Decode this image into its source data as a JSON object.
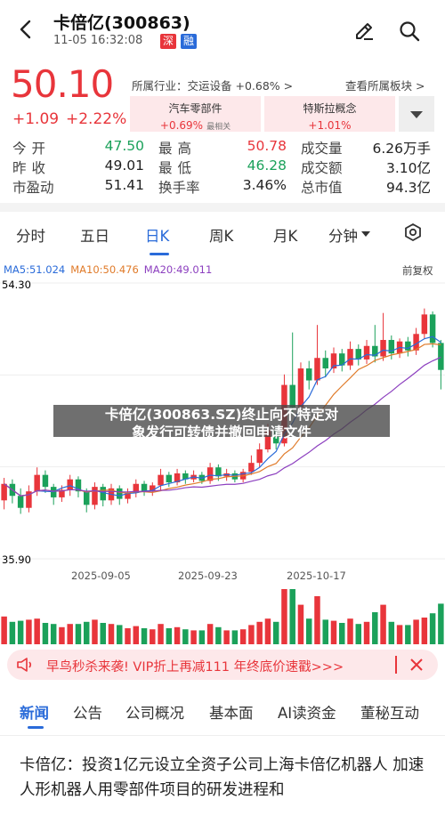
{
  "header": {
    "title": "卡倍亿(300863)",
    "time": "11-05 16:32:08",
    "tag_shen": "深",
    "tag_rong": "融"
  },
  "quote": {
    "price": "50.10",
    "change": "+1.09",
    "change_pct": "+2.22%",
    "industry": "所属行业：交运设备 +0.68% >",
    "view_sector": "查看所属板块 >",
    "sectors": [
      {
        "name": "汽车零部件",
        "pct": "+0.69%",
        "lead": "最相关"
      },
      {
        "name": "特斯拉概念",
        "pct": "+1.01%"
      }
    ]
  },
  "stats": {
    "row1": [
      {
        "label": "今开",
        "value": "47.50",
        "color": "#1ba15a"
      },
      {
        "label": "最高",
        "value": "50.78",
        "color": "#e8353b"
      },
      {
        "label": "成交量",
        "value": "6.26万手",
        "color": "#222222"
      }
    ],
    "row2": [
      {
        "label": "昨收",
        "value": "49.01",
        "color": "#222222"
      },
      {
        "label": "最低",
        "value": "46.28",
        "color": "#1ba15a"
      },
      {
        "label": "成交额",
        "value": "3.10亿",
        "color": "#222222"
      }
    ],
    "row3": [
      {
        "label": "市盈动",
        "value": "51.41",
        "color": "#222222"
      },
      {
        "label": "换手率",
        "value": "3.46%",
        "color": "#222222"
      },
      {
        "label": "总市值",
        "value": "94.3亿",
        "color": "#222222"
      }
    ]
  },
  "tabs": [
    "分时",
    "五日",
    "日K",
    "周K",
    "月K",
    "分钟"
  ],
  "chart": {
    "ma5": "MA5:51.024",
    "ma10": "MA10:50.476",
    "ma20": "MA20:49.011",
    "adjust": "前复权",
    "ymax": "54.30",
    "ymin": "35.90",
    "dates": [
      "2025-09-05",
      "2025-09-23",
      "2025-10-17"
    ]
  },
  "chart_data": {
    "type": "candlestick",
    "ylim": [
      35.9,
      54.3
    ],
    "x_ticks": [
      "2025-09-05",
      "2025-09-23",
      "2025-10-17"
    ],
    "candles": [
      [
        39.8,
        40.9,
        39.2,
        41.3
      ],
      [
        40.9,
        40.1,
        39.6,
        41.2
      ],
      [
        40.1,
        39.3,
        38.9,
        40.6
      ],
      [
        39.3,
        40.4,
        39.0,
        40.8
      ],
      [
        40.4,
        41.5,
        40.1,
        42.0
      ],
      [
        41.5,
        40.7,
        40.3,
        41.8
      ],
      [
        40.7,
        40.0,
        39.5,
        40.9
      ],
      [
        40.0,
        40.5,
        39.7,
        40.8
      ],
      [
        40.5,
        41.2,
        40.1,
        41.5
      ],
      [
        41.2,
        40.4,
        40.0,
        41.4
      ],
      [
        40.4,
        39.5,
        39.0,
        40.6
      ],
      [
        39.5,
        40.7,
        39.2,
        41.0
      ],
      [
        40.7,
        39.8,
        39.4,
        40.9
      ],
      [
        39.8,
        40.6,
        39.5,
        40.9
      ],
      [
        40.6,
        39.9,
        39.5,
        40.8
      ],
      [
        39.9,
        40.3,
        39.6,
        40.6
      ],
      [
        40.3,
        40.9,
        40.0,
        41.2
      ],
      [
        40.9,
        40.4,
        40.1,
        41.1
      ],
      [
        40.4,
        40.8,
        40.1,
        41.0
      ],
      [
        40.8,
        41.5,
        40.5,
        41.9
      ],
      [
        41.5,
        41.0,
        40.7,
        41.7
      ],
      [
        41.0,
        41.6,
        40.8,
        41.9
      ],
      [
        41.6,
        41.2,
        40.9,
        41.8
      ],
      [
        41.2,
        41.5,
        41.0,
        41.8
      ],
      [
        41.5,
        41.1,
        40.9,
        41.7
      ],
      [
        41.1,
        42.0,
        40.9,
        42.3
      ],
      [
        42.0,
        41.4,
        41.1,
        42.2
      ],
      [
        41.4,
        41.6,
        41.1,
        41.9
      ],
      [
        41.6,
        41.2,
        41.0,
        41.8
      ],
      [
        41.2,
        41.7,
        41.0,
        41.9
      ],
      [
        41.7,
        42.3,
        41.5,
        42.8
      ],
      [
        42.3,
        43.2,
        42.0,
        43.6
      ],
      [
        43.2,
        44.5,
        43.0,
        44.9
      ],
      [
        44.5,
        43.6,
        43.2,
        44.8
      ],
      [
        43.6,
        47.5,
        43.4,
        48.2
      ],
      [
        47.5,
        46.0,
        45.5,
        51.0
      ],
      [
        46.0,
        48.6,
        45.8,
        49.0
      ],
      [
        48.6,
        47.8,
        47.2,
        49.1
      ],
      [
        47.8,
        49.3,
        47.5,
        51.5
      ],
      [
        49.3,
        48.6,
        48.0,
        49.8
      ],
      [
        48.6,
        49.6,
        48.3,
        50.0
      ],
      [
        49.6,
        48.8,
        48.4,
        49.9
      ],
      [
        48.8,
        49.9,
        48.5,
        50.4
      ],
      [
        49.9,
        49.2,
        48.8,
        50.2
      ],
      [
        49.2,
        50.1,
        48.9,
        50.5
      ],
      [
        50.1,
        49.4,
        49.0,
        51.5
      ],
      [
        49.4,
        50.5,
        49.1,
        52.3
      ],
      [
        50.5,
        49.6,
        49.2,
        50.8
      ],
      [
        49.6,
        50.4,
        49.3,
        50.6
      ],
      [
        50.4,
        49.8,
        49.4,
        50.7
      ],
      [
        49.8,
        50.9,
        49.5,
        51.3
      ],
      [
        50.9,
        52.2,
        50.6,
        52.6
      ],
      [
        52.2,
        50.3,
        50.0,
        52.4
      ],
      [
        50.3,
        48.5,
        47.2,
        50.5
      ]
    ]
  },
  "overlay": {
    "line1": "卡倍亿(300863.SZ)终止向不特定对",
    "line2": "象发行可转债并撤回申请文件"
  },
  "promo": {
    "text": "早鸟秒杀来袭! VIP折上再减111 年终底价速戳>>>"
  },
  "news_tabs": [
    "新闻",
    "公告",
    "公司概况",
    "基本面",
    "AI读资金",
    "董秘互动"
  ],
  "headline": "卡倍亿：投资1亿元设立全资子公司上海卡倍亿机器人 加速人形机器人用零部件项目的研发进程和",
  "colors": {
    "up": "#e8353b",
    "down": "#1ba15a",
    "accent": "#2a6bd9"
  }
}
